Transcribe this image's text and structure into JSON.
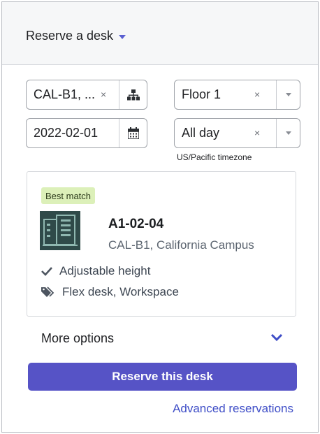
{
  "header": {
    "title": "Reserve a desk"
  },
  "filters": {
    "location": {
      "value": "CAL-B1, ...",
      "clear": "×",
      "icon": "hierarchy-icon"
    },
    "floor": {
      "value": "Floor 1",
      "clear": "×",
      "icon": "dropdown-caret-icon"
    },
    "date": {
      "value": "2022-02-01",
      "icon": "calendar-icon"
    },
    "time": {
      "value": "All day",
      "clear": "×",
      "icon": "dropdown-caret-icon"
    },
    "timezone": "US/Pacific timezone"
  },
  "result": {
    "badge": "Best match",
    "desk_id": "A1-02-04",
    "location": "CAL-B1, California Campus",
    "features": [
      {
        "icon": "check-icon",
        "label": "Adjustable height"
      },
      {
        "icon": "tags-icon",
        "label": "Flex desk, Workspace"
      }
    ]
  },
  "more_options": "More options",
  "reserve_button": "Reserve this desk",
  "advanced_link": "Advanced reservations",
  "colors": {
    "accent": "#5653c6",
    "link": "#3f4ec7",
    "badge_bg": "#dcf0b9",
    "building_icon": "#2f4a49"
  }
}
